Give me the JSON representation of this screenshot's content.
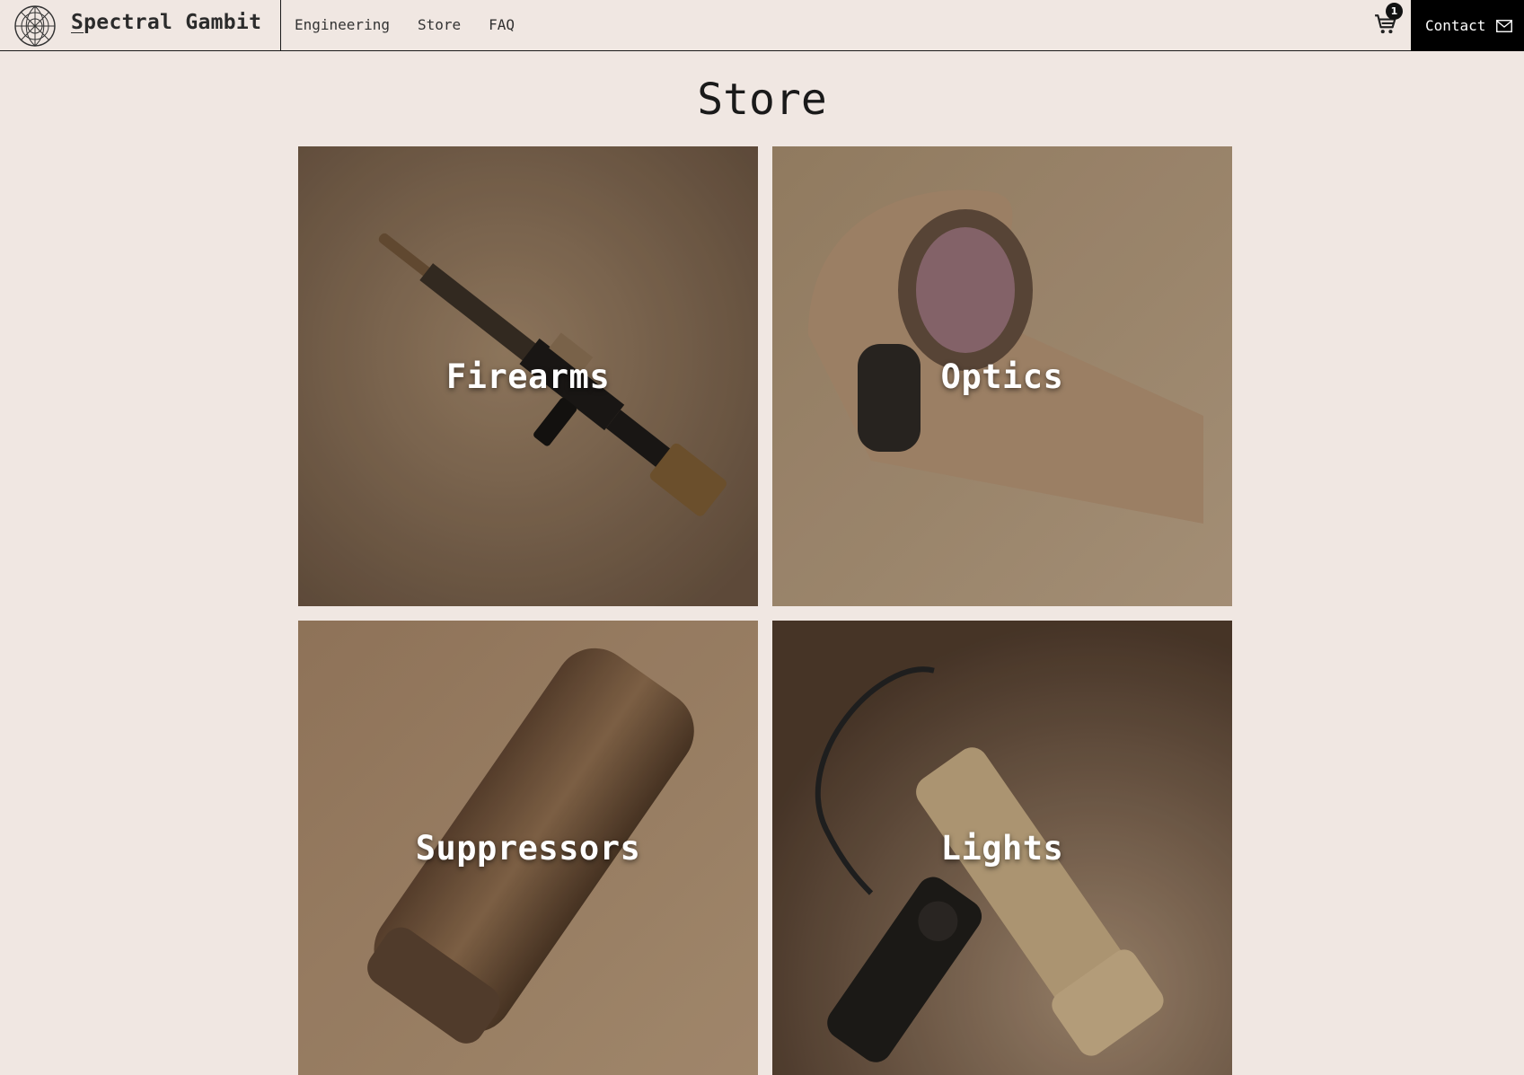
{
  "brand": {
    "name_first": "S",
    "name_rest": "pectral Gambit"
  },
  "nav": {
    "links": [
      "Engineering",
      "Store",
      "FAQ"
    ],
    "cart_count": "1",
    "contact_label": "Contact"
  },
  "page": {
    "title": "Store"
  },
  "categories": [
    {
      "label": "Firearms"
    },
    {
      "label": "Optics"
    },
    {
      "label": "Suppressors"
    },
    {
      "label": "Lights"
    }
  ],
  "colors": {
    "background": "#f0e7e2",
    "nav_border": "#1a1a1a",
    "contact_bg": "#000000",
    "badge_bg": "#111111"
  },
  "icons": [
    "globe-logo-icon",
    "cart-icon",
    "mail-icon"
  ]
}
